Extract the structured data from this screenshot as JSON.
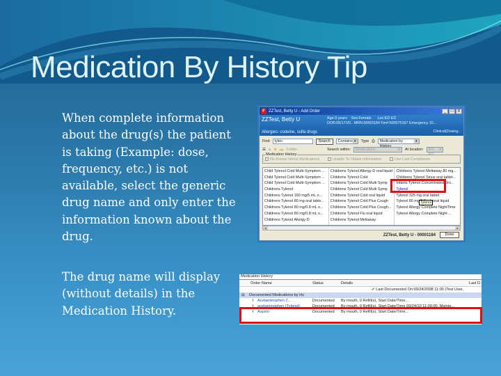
{
  "slide": {
    "title": "Medication By History Tip",
    "paragraph1": "When complete information about the drug(s) the patient is taking (Example: dose, frequency, etc.) is not available,  select the generic drug name and only enter the information known about the drug.",
    "paragraph2": "The  drug name will display (without details) in the Medication History."
  },
  "add_order_window": {
    "title": "ZZTest, Betty U - Add Order",
    "controls": {
      "minimize": "_",
      "maximize": "□",
      "close": "X"
    },
    "patient": {
      "name": "ZZTest, Betty U",
      "age": "Age:3 years",
      "sex": "Sex:Female",
      "loc": "Loc:ED ED",
      "dob": "DOB:06/17/20..",
      "mrn": "MRN:00001184",
      "fin": "Fin#:000075167 Emergency 10...",
      "status": "Clinical(Dosing...",
      "allergies": "Allergies: codeine, sulfa drugs"
    },
    "search": {
      "find_label": "Find",
      "find_value": "tylen",
      "search_button": "Search",
      "match_type": "Contains",
      "type_label": "Type",
      "type_value": "Medication by History",
      "search_within_label": "Search within:",
      "search_within_value": "Medications",
      "at_location_label": "At location:",
      "at_location_value": "ED-ED",
      "folder_label": "Folder:",
      "med_history_legend": "Medication History",
      "checkboxes": [
        "No Known Home Medications",
        "Unable To Obtain Information",
        "Use Last Compliance"
      ]
    },
    "results": {
      "col1": [
        "Child Tylenol Cold Multi-Symptom ...",
        "Child Tylenol Cold Multi-Symptom ...",
        "Child Tylenol Cold Multi-Symptom ...",
        "Childrens Tylenol",
        "Childrens Tylenol 160 mg/5 mL o...",
        "Childrens Tylenol 80 mg oral table...",
        "Childrens Tylenol 80 mg/0.8 mL o...",
        "Childrens Tylenol 80 mg/0.8 mL o...",
        "Childrens Tylenol Allergy-D"
      ],
      "col2": [
        "Childrens Tylenol Allergy-D oral liquid",
        "Childrens Tylenol Cold",
        "Childrens Tylenol Cold Multi Symp",
        "Childrens Tylenol Cold Multi Symp",
        "Childrens Tylenol Cold oral liquid",
        "Childrens Tylenol Cold Plus Cough",
        "Childrens Tylenol Cold Plus Cough...",
        "Childrens Tylenol Flu oral liquid",
        "Childrens Tylenol Meltaway"
      ],
      "col3": [
        "Childrens Tylenol Meltaway 80 mg...",
        "Childrens Tylenol Sinus oral tablet...",
        "Infants Tylenol Concentrated Dro...",
        "Tylenol",
        "Tylenol 325 mg oral tablet",
        "Tylenol 80 mg/0.8 mL oral liquid",
        "Tylenol Allergy Complete NightTime",
        "Tylenol Allergy Complete Night ..."
      ],
      "tooltip": "Tylenol"
    },
    "footer": {
      "patient_id": "ZZTest, Betty U - 00001184",
      "done_button": "Done"
    }
  },
  "medication_history": {
    "title": "Medication History",
    "columns": [
      "Order Name",
      "Status",
      "Details",
      "Last D"
    ],
    "last_documented": "Last Documented On:09/24/2008 11:00 (Test User,",
    "group": "Documented Medications by Hx",
    "rows": [
      {
        "name": "Acetaminophen 2...",
        "status": "Documented",
        "details": "By mouth, 0 Refill(s), Start Date/Time..."
      },
      {
        "name": "acetaminophen (Tylenol)",
        "status": "Documented",
        "details": "By mouth, 0 Refill(s), Start Date/Time 09/24/10 11:09:00, Mainte..."
      },
      {
        "name": "Aspirin",
        "status": "Documented",
        "details": "By mouth, 0 Refill(s), Start Date/Time..."
      }
    ]
  }
}
